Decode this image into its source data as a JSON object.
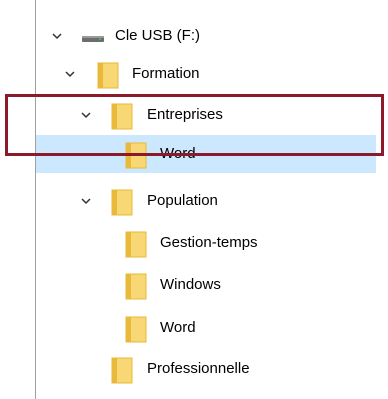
{
  "tree": {
    "items": [
      {
        "label": "Cle USB (F:)",
        "icon": "usb-drive-icon",
        "expanded": true,
        "selected": false
      },
      {
        "label": "Formation",
        "icon": "folder-icon",
        "expanded": true,
        "selected": false
      },
      {
        "label": "Entreprises",
        "icon": "folder-icon",
        "expanded": true,
        "selected": false
      },
      {
        "label": "Word",
        "icon": "folder-icon",
        "expanded": false,
        "selected": true
      },
      {
        "label": "Population",
        "icon": "folder-icon",
        "expanded": true,
        "selected": false
      },
      {
        "label": "Gestion-temps",
        "icon": "folder-icon",
        "expanded": false,
        "selected": false
      },
      {
        "label": "Windows",
        "icon": "folder-icon",
        "expanded": false,
        "selected": false
      },
      {
        "label": "Word",
        "icon": "folder-icon",
        "expanded": false,
        "selected": false
      },
      {
        "label": "Professionnelle",
        "icon": "folder-icon",
        "expanded": false,
        "selected": false
      }
    ]
  },
  "colors": {
    "selection": "#cce8ff",
    "folder": "#f8d775",
    "folder_shade": "#e8b93a",
    "highlight_border": "#8b1a2b",
    "pane_border": "#a0a0a0"
  }
}
